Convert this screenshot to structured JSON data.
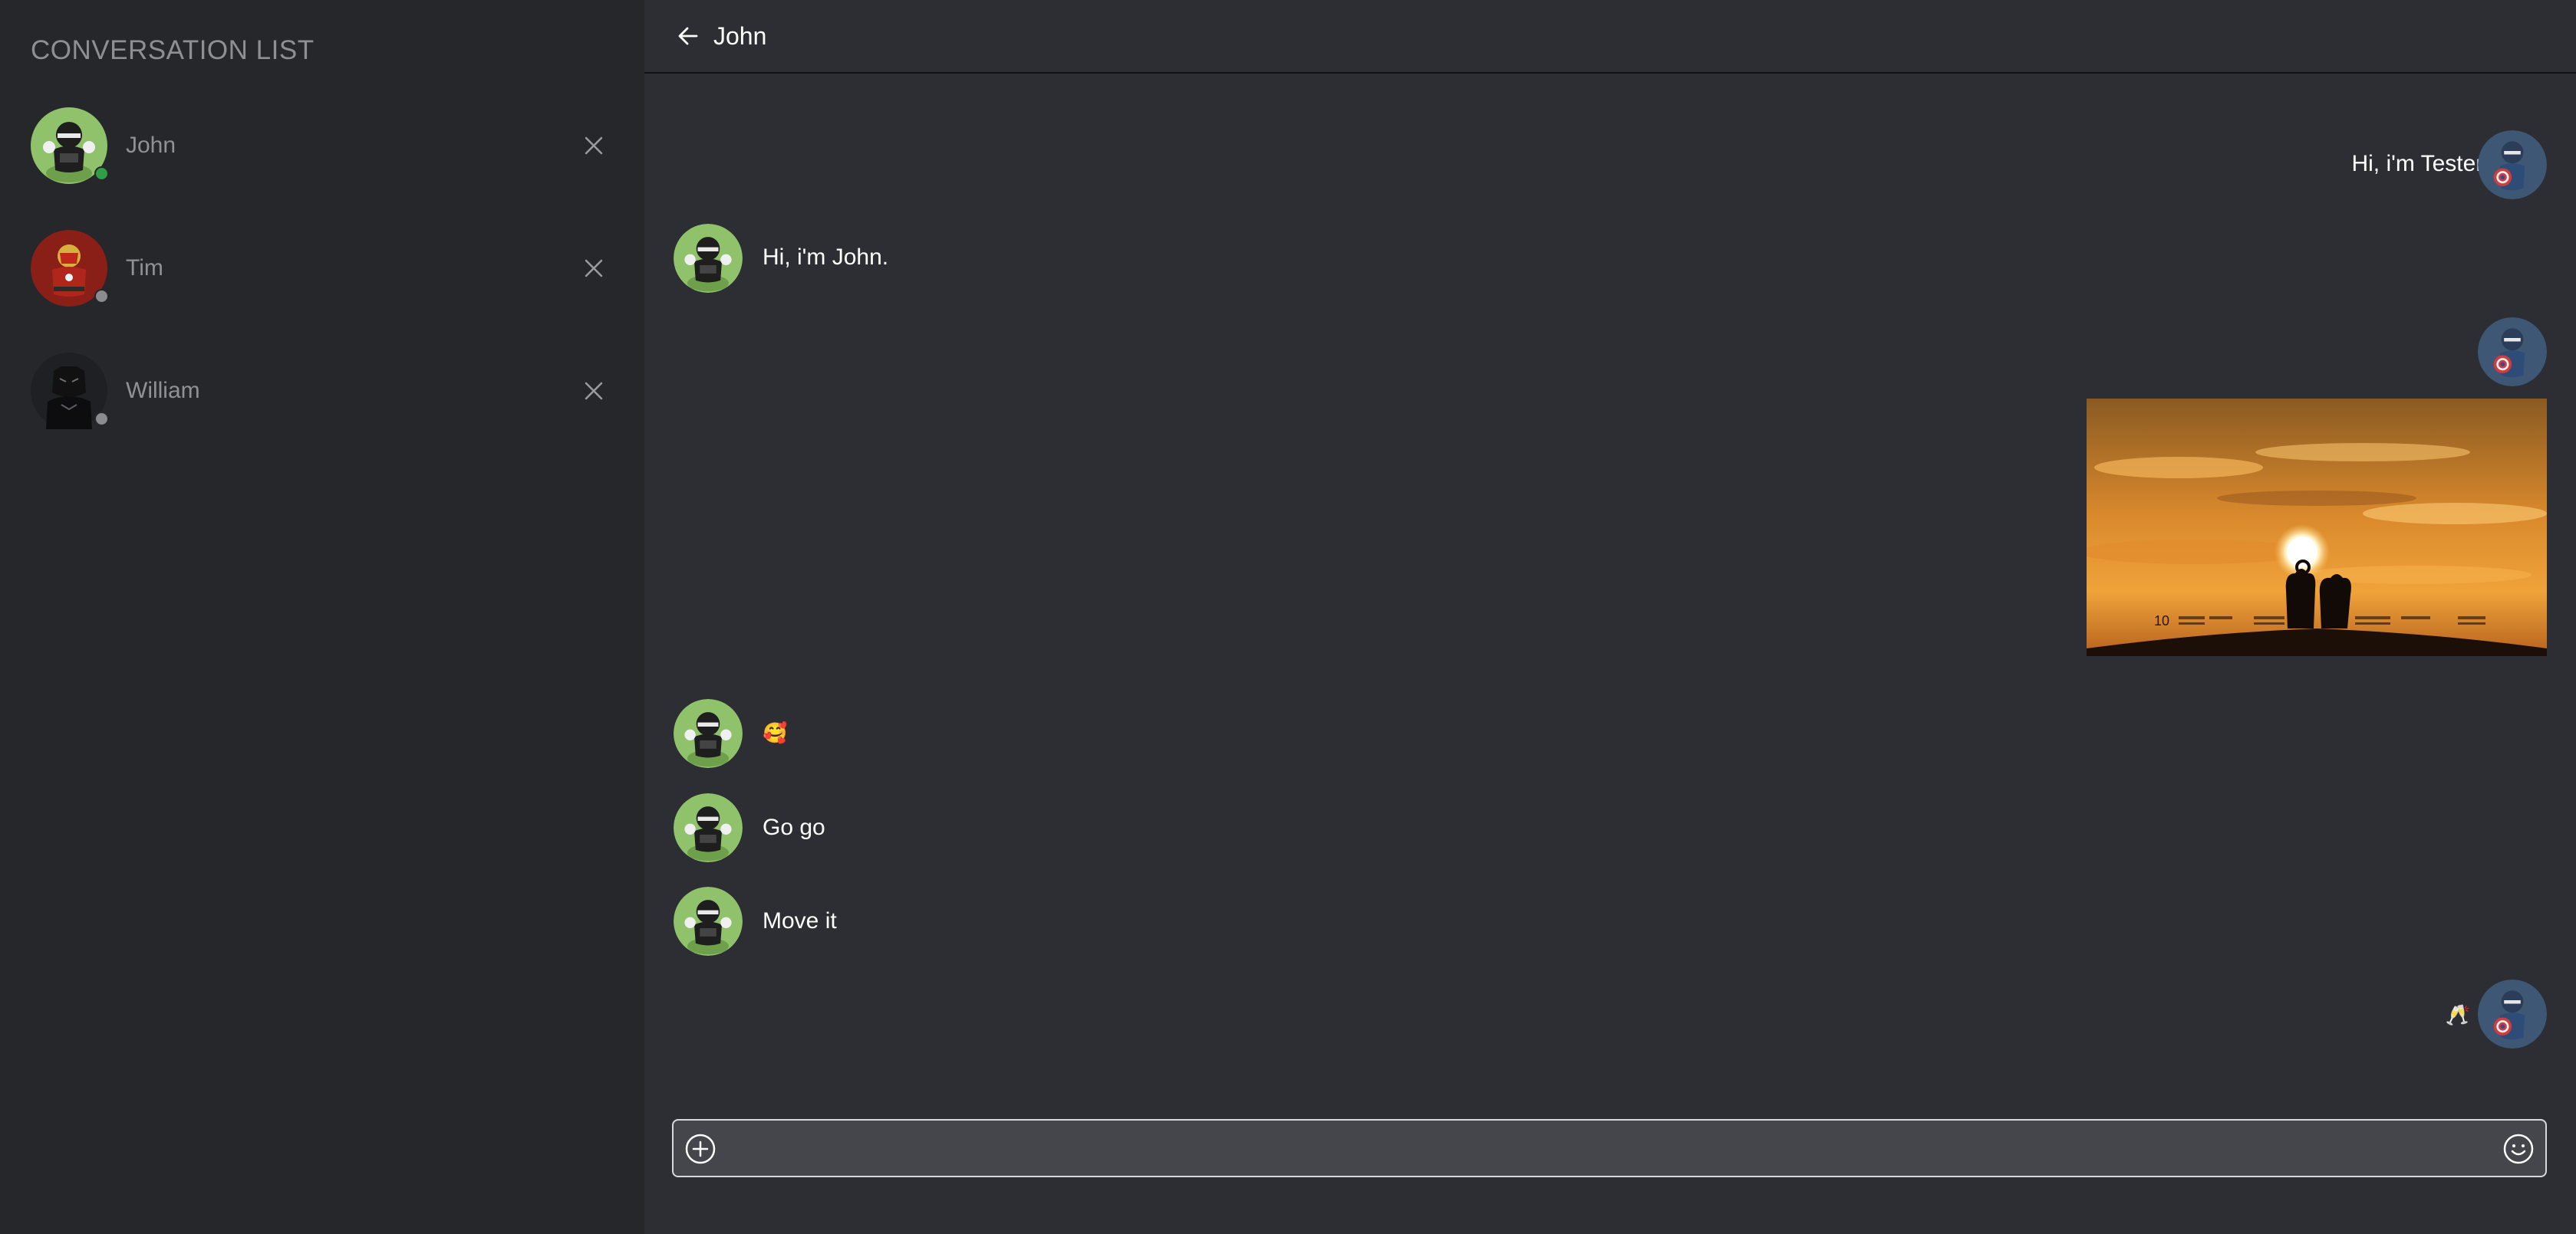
{
  "sidebar": {
    "title": "CONVERSATION LIST",
    "items": [
      {
        "name": "John",
        "status": "online",
        "status_color": "#2f9e44",
        "avatar_icon": "hero-avatar-green"
      },
      {
        "name": "Tim",
        "status": "offline",
        "status_color": "#8b8c90",
        "avatar_icon": "iron-hero-avatar"
      },
      {
        "name": "William",
        "status": "offline",
        "status_color": "#8b8c90",
        "avatar_icon": "panther-avatar"
      }
    ]
  },
  "header": {
    "title": "John"
  },
  "messages": [
    {
      "sender": "Tester",
      "side": "right",
      "type": "text",
      "text": "Hi, i'm Tester."
    },
    {
      "sender": "John",
      "side": "left",
      "type": "text",
      "text": "Hi, i'm John."
    },
    {
      "sender": "Tester",
      "side": "right",
      "type": "image",
      "image_text": "10"
    },
    {
      "sender": "John",
      "side": "left",
      "type": "emoji",
      "text": "🥰"
    },
    {
      "sender": "John",
      "side": "left",
      "type": "text",
      "text": "Go go"
    },
    {
      "sender": "John",
      "side": "left",
      "type": "text",
      "text": "Move it"
    },
    {
      "sender": "Tester",
      "side": "right",
      "type": "emoji",
      "text": "🥂"
    }
  ],
  "composer": {
    "placeholder": "",
    "value": ""
  },
  "colors": {
    "sidebar_bg": "#26272b",
    "main_bg": "#2d2e33",
    "online": "#2f9e44",
    "offline": "#8b8c90"
  }
}
